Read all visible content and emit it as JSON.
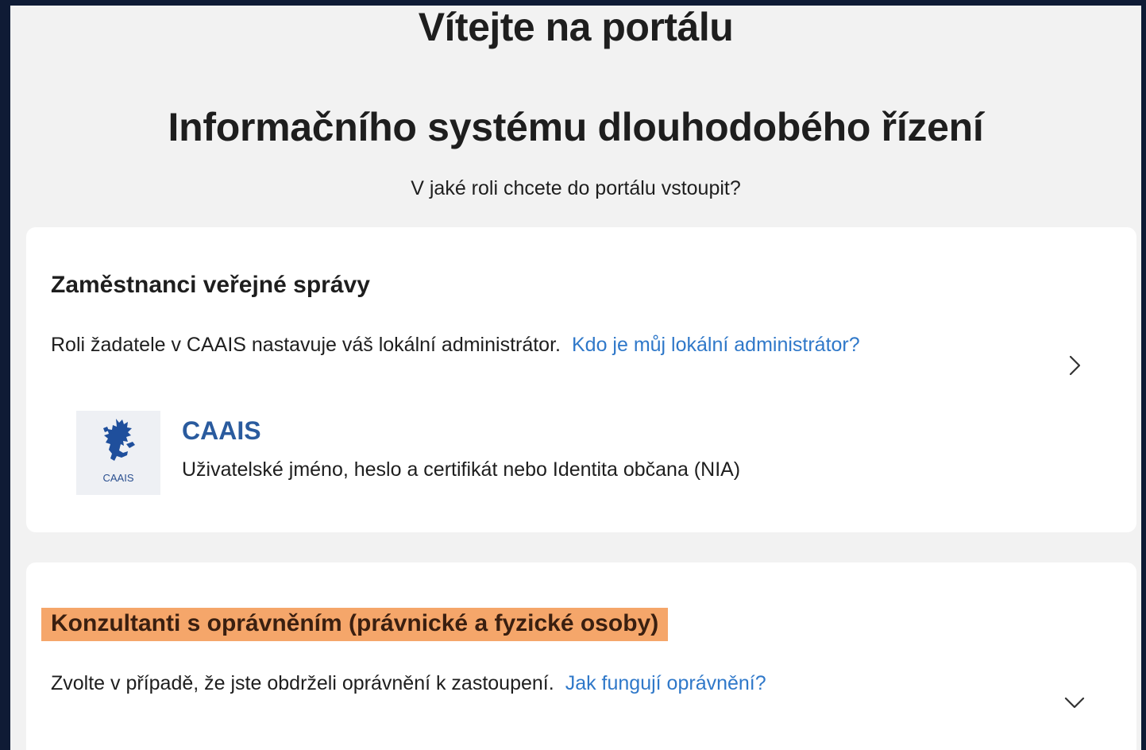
{
  "page": {
    "welcome_title": "Vítejte na portálu",
    "system_title": "Informačního systému dlouhodobého řízení",
    "role_question": "V jaké roli chcete do portálu vstoupit?"
  },
  "employees_card": {
    "heading": "Zaměstnanci veřejné správy",
    "description": "Roli žadatele v CAAIS nastavuje váš lokální administrátor.",
    "help_link": "Kdo je můj lokální administrátor?",
    "chevron_icon": "chevron-right-icon",
    "provider": {
      "logo_icon": "czech-lion-icon",
      "logo_text": "CAAIS",
      "name": "CAAIS",
      "description": "Uživatelské jméno, heslo a certifikát nebo Identita občana (NIA)"
    }
  },
  "consultants_card": {
    "heading": "Konzultanti s oprávněním (právnické a fyzické osoby)",
    "description": "Zvolte v případě, že jste obdrželi oprávnění k zastoupení.",
    "help_link": "Jak fungují oprávnění?",
    "chevron_icon": "chevron-down-icon",
    "highlight_color": "#f5a66a"
  },
  "colors": {
    "background": "#f2f2f2",
    "card": "#ffffff",
    "link": "#2f78c9",
    "provider_name": "#2a5b9e",
    "frame": "#0f1b35"
  }
}
